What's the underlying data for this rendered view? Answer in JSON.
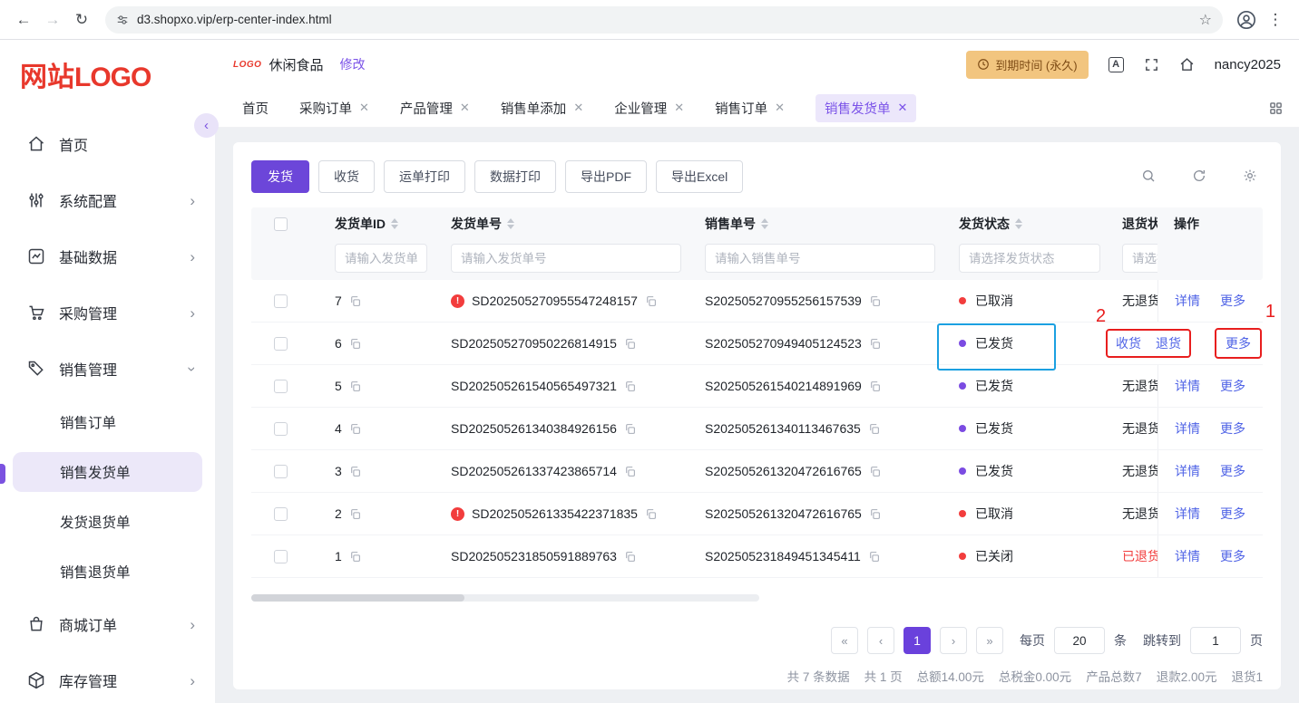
{
  "browser": {
    "url": "d3.shopxo.vip/erp-center-index.html"
  },
  "sidebar": {
    "logo_red": "网站",
    "logo_bold": "LOGO",
    "items": [
      {
        "label": "首页"
      },
      {
        "label": "系统配置"
      },
      {
        "label": "基础数据"
      },
      {
        "label": "采购管理"
      },
      {
        "label": "销售管理"
      },
      {
        "label": "销售订单"
      },
      {
        "label": "销售发货单"
      },
      {
        "label": "发货退货单"
      },
      {
        "label": "销售退货单"
      },
      {
        "label": "商城订单"
      },
      {
        "label": "库存管理"
      }
    ]
  },
  "header": {
    "mini_logo": "LOGO",
    "company": "休闲食品",
    "modify": "修改",
    "expiry": "到期时间 (永久)",
    "username": "nancy2025"
  },
  "tabs": [
    {
      "label": "首页"
    },
    {
      "label": "采购订单"
    },
    {
      "label": "产品管理"
    },
    {
      "label": "销售单添加"
    },
    {
      "label": "企业管理"
    },
    {
      "label": "销售订单"
    },
    {
      "label": "销售发货单"
    }
  ],
  "toolbar": {
    "ship": "发货",
    "receive": "收货",
    "waybill_print": "运单打印",
    "data_print": "数据打印",
    "export_pdf": "导出PDF",
    "export_excel": "导出Excel"
  },
  "table": {
    "columns": [
      "发货单ID",
      "发货单号",
      "销售单号",
      "发货状态",
      "退货状态",
      "操作"
    ],
    "filters": [
      "请输入发货单ID",
      "请输入发货单号",
      "请输入销售单号",
      "请选择发货状态",
      "请选择退货状态"
    ],
    "action_labels": {
      "detail": "详情",
      "more": "更多",
      "receive": "收货",
      "refund": "退货"
    },
    "rows": [
      {
        "id": "7",
        "delivery_no": "SD202505270955547248157",
        "sales_no": "S202505270955256157539",
        "status": "已取消",
        "return_status": "无退货"
      },
      {
        "id": "6",
        "delivery_no": "SD202505270950226814915",
        "sales_no": "S202505270949405124523",
        "status": "已发货",
        "return_status": ""
      },
      {
        "id": "5",
        "delivery_no": "SD202505261540565497321",
        "sales_no": "S202505261540214891969",
        "status": "已发货",
        "return_status": "无退货"
      },
      {
        "id": "4",
        "delivery_no": "SD202505261340384926156",
        "sales_no": "S202505261340113467635",
        "status": "已发货",
        "return_status": "无退货"
      },
      {
        "id": "3",
        "delivery_no": "SD202505261337423865714",
        "sales_no": "S202505261320472616765",
        "status": "已发货",
        "return_status": "无退货"
      },
      {
        "id": "2",
        "delivery_no": "SD202505261335422371835",
        "sales_no": "S202505261320472616765",
        "status": "已取消",
        "return_status": "无退货"
      },
      {
        "id": "1",
        "delivery_no": "SD202505231850591889763",
        "sales_no": "S202505231849451345411",
        "status": "已关闭",
        "return_status": "已退货"
      }
    ]
  },
  "pagination": {
    "first": "«",
    "prev": "‹",
    "page": "1",
    "next": "›",
    "last": "»",
    "per_page_label": "每页",
    "per_page_value": "20",
    "per_page_unit": "条",
    "jump_label": "跳转到",
    "jump_value": "1",
    "jump_unit": "页"
  },
  "summary": {
    "items": [
      "共 7 条数据",
      "共 1 页",
      "总额14.00元",
      "总税金0.00元",
      "产品总数7",
      "退款2.00元",
      "退货1"
    ]
  },
  "annotations": {
    "one": "1",
    "two": "2"
  }
}
